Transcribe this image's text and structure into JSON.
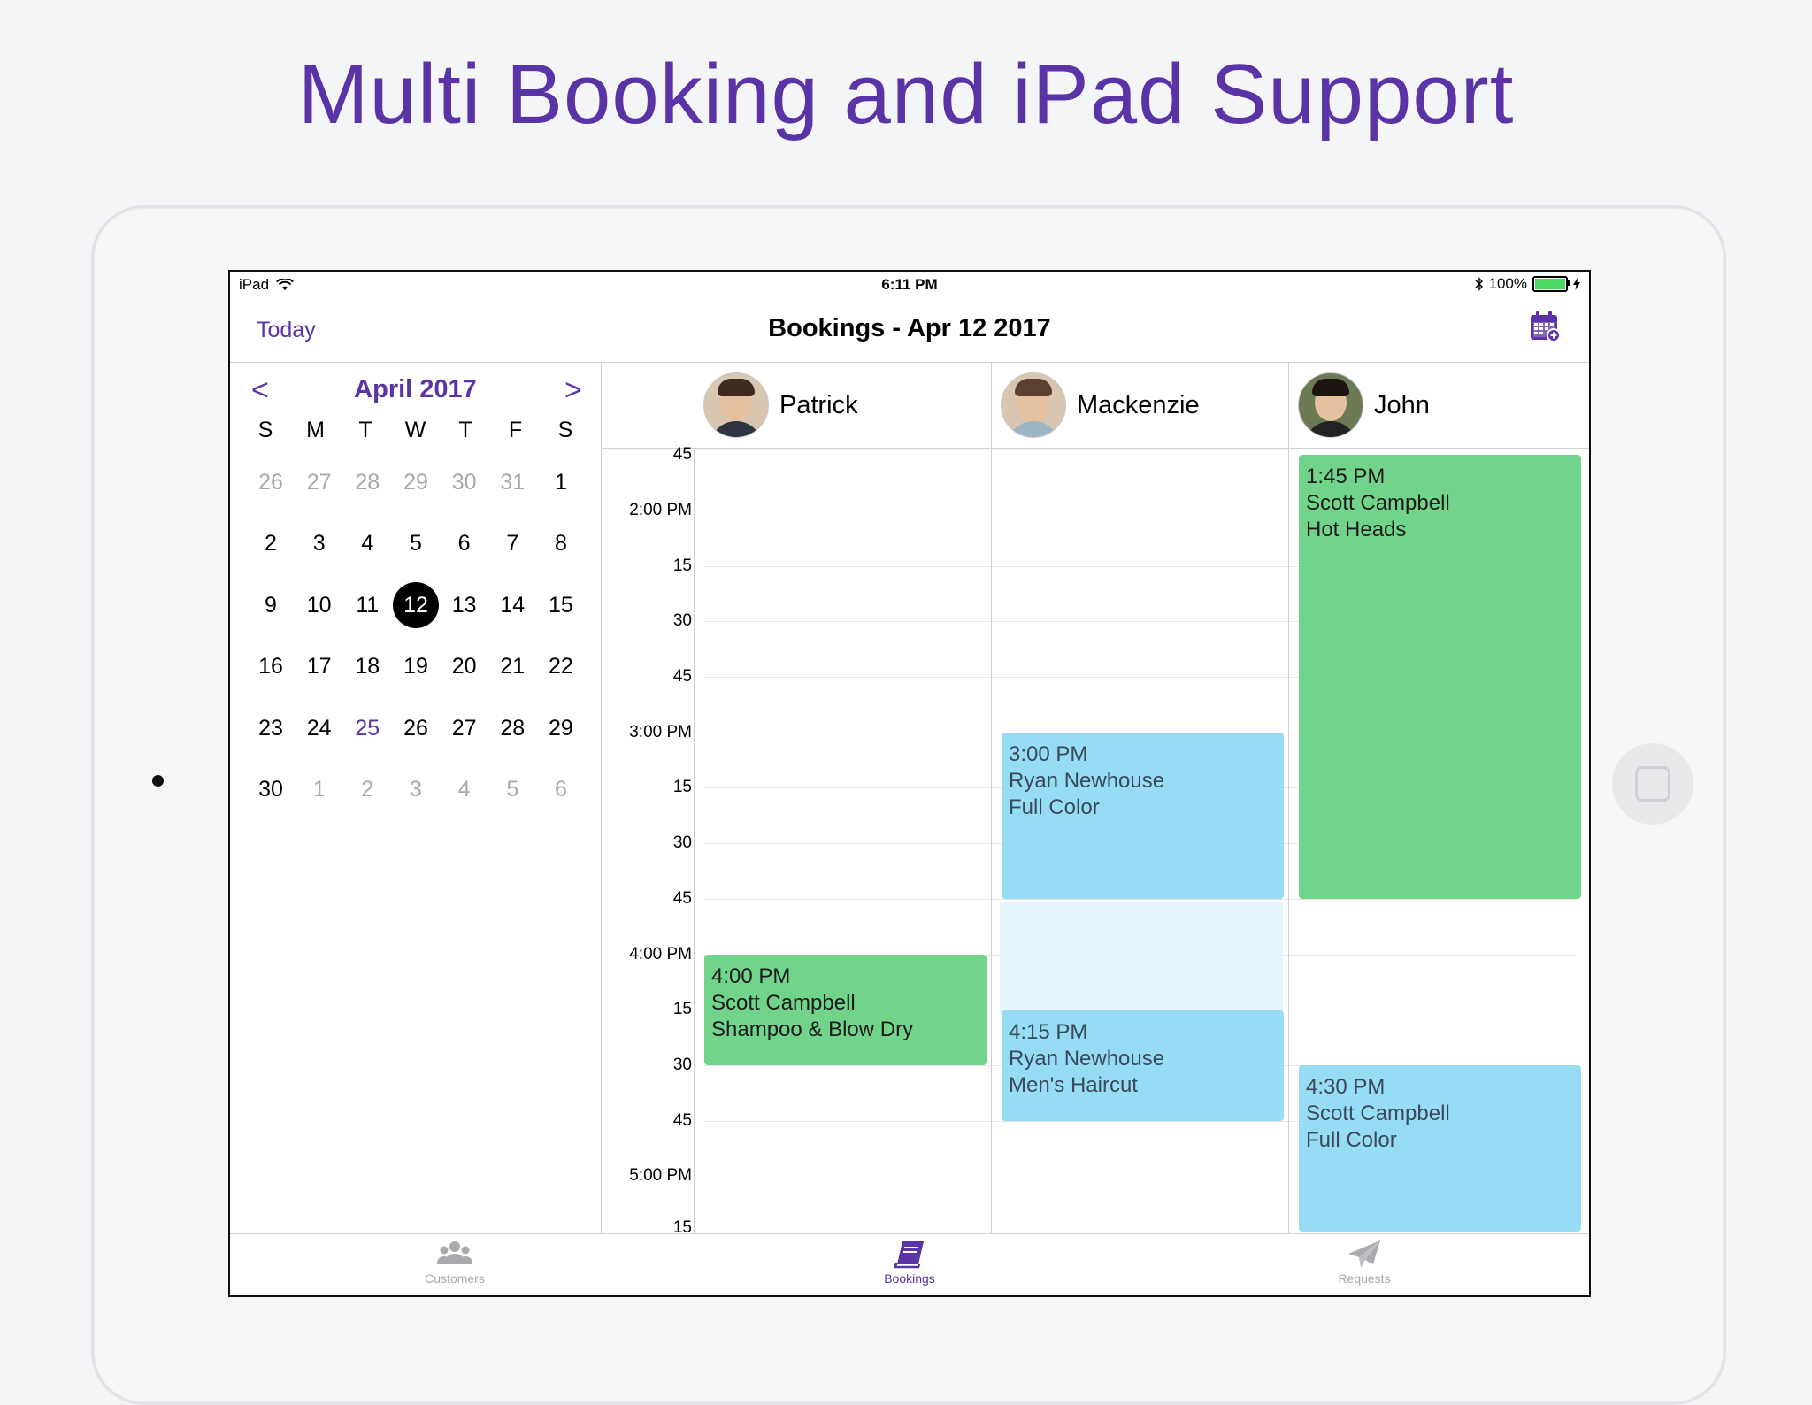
{
  "headline": "Multi Booking and iPad Support",
  "status_bar": {
    "device": "iPad",
    "time": "6:11 PM",
    "battery": "100%"
  },
  "nav": {
    "today": "Today",
    "title": "Bookings - Apr 12 2017",
    "add_icon": "calendar-add-icon"
  },
  "calendar": {
    "month": "April 2017",
    "prev": "<",
    "next": ">",
    "weekdays": [
      "S",
      "M",
      "T",
      "W",
      "T",
      "F",
      "S"
    ],
    "weeks": [
      [
        "26",
        "27",
        "28",
        "29",
        "30",
        "31",
        "1"
      ],
      [
        "2",
        "3",
        "4",
        "5",
        "6",
        "7",
        "8"
      ],
      [
        "9",
        "10",
        "11",
        "12",
        "13",
        "14",
        "15"
      ],
      [
        "16",
        "17",
        "18",
        "19",
        "20",
        "21",
        "22"
      ],
      [
        "23",
        "24",
        "25",
        "26",
        "27",
        "28",
        "29"
      ],
      [
        "30",
        "1",
        "2",
        "3",
        "4",
        "5",
        "6"
      ]
    ],
    "selected": "12",
    "today": "25"
  },
  "staff": [
    "Patrick",
    "Mackenzie",
    "John"
  ],
  "time_labels": [
    "45",
    "2:00 PM",
    "15",
    "30",
    "45",
    "3:00 PM",
    "15",
    "30",
    "45",
    "4:00 PM",
    "15",
    "30",
    "45",
    "5:00 PM",
    "15"
  ],
  "bookings": {
    "patrick_1": {
      "time": "4:00 PM",
      "client": "Scott Campbell",
      "service": "Shampoo & Blow Dry",
      "color": "#72d38a"
    },
    "mackenzie_1": {
      "time": "3:00 PM",
      "client": "Ryan Newhouse",
      "service": "Full Color",
      "color": "#97dcf5"
    },
    "mackenzie_2": {
      "time": "4:15 PM",
      "client": "Ryan Newhouse",
      "service": "Men's Haircut",
      "color": "#97dcf5"
    },
    "john_1": {
      "time": "1:45 PM",
      "client": "Scott Campbell",
      "service": "Hot Heads",
      "color": "#72d38a"
    },
    "john_2": {
      "time": "4:30 PM",
      "client": "Scott Campbell",
      "service": "Full Color",
      "color": "#97dcf5"
    }
  },
  "tabs": {
    "customers": "Customers",
    "bookings": "Bookings",
    "requests": "Requests"
  },
  "colors": {
    "accent": "#5a33a6",
    "green": "#72d38a",
    "blue": "#97dcf5"
  }
}
